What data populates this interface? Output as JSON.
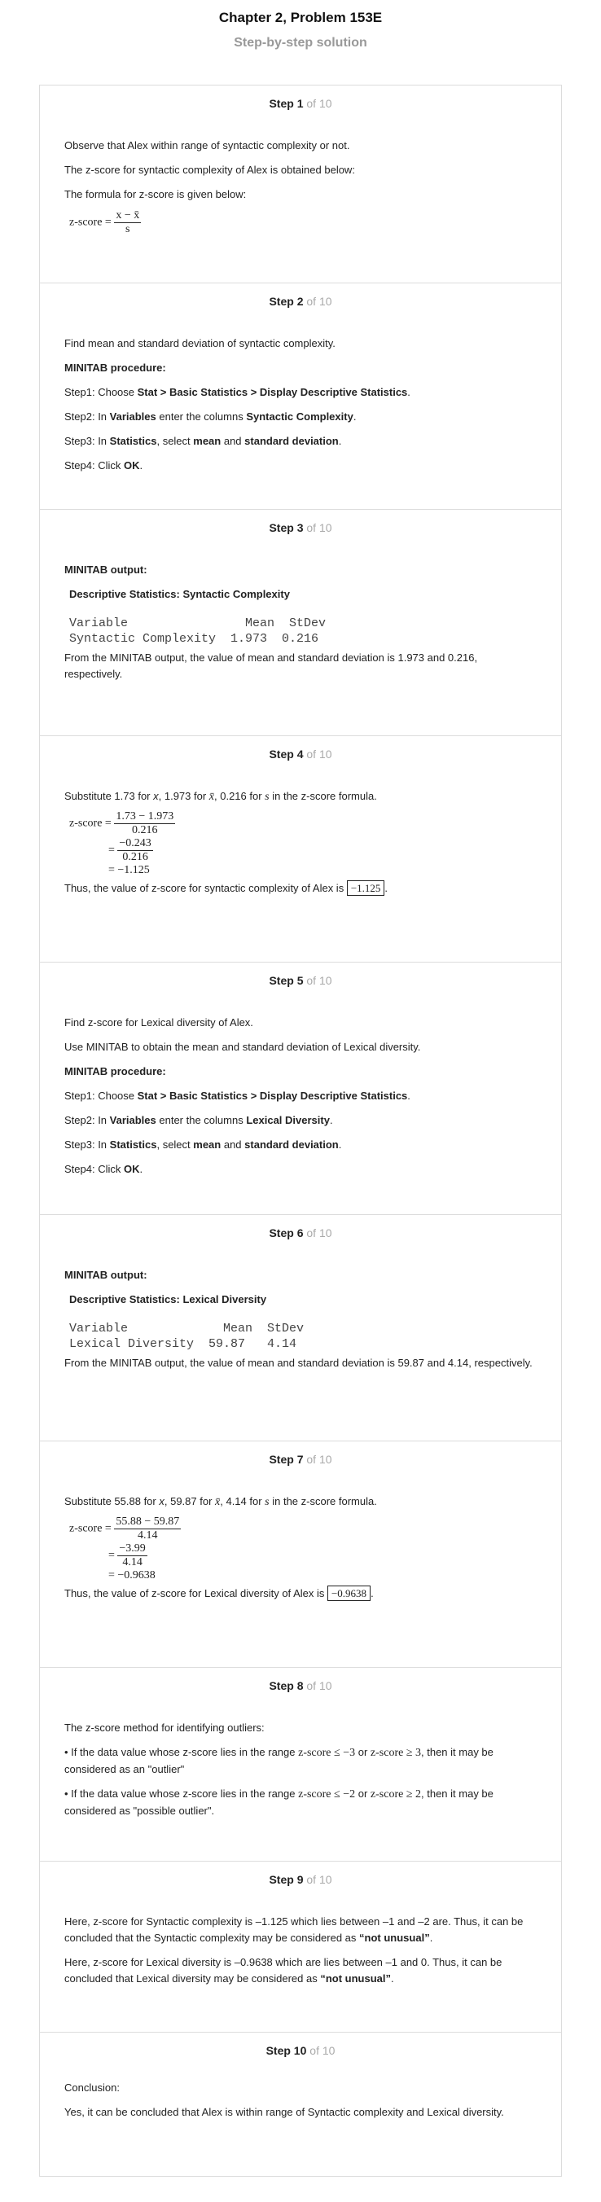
{
  "header": {
    "title": "Chapter 2, Problem 153E",
    "subtitle": "Step-by-step solution"
  },
  "of_label": "of 10",
  "steps": {
    "s1": {
      "label": "Step 1",
      "p1": "Observe that Alex within range of syntactic complexity or not.",
      "p2": "The z-score for syntactic complexity of Alex is obtained below:",
      "p3": "The formula for z-score is given below:",
      "lhs": "z-score =",
      "num": "x − x̄",
      "den": "s"
    },
    "s2": {
      "label": "Step 2",
      "p1": "Find mean and standard deviation of syntactic complexity.",
      "proc": "MINITAB procedure:",
      "step1_pre": "Step1: Choose ",
      "step1_bold": "Stat > Basic Statistics > Display Descriptive Statistics",
      "step1_post": ".",
      "step2_pre": "Step2: In ",
      "step2_bold1": "Variables",
      "step2_mid": " enter the columns ",
      "step2_bold2": "Syntactic Complexity",
      "step2_post": ".",
      "step3_pre": "Step3: In ",
      "step3_bold1": "Statistics",
      "step3_mid1": ", select ",
      "step3_bold2": "mean",
      "step3_mid2": " and ",
      "step3_bold3": "standard deviation",
      "step3_post": ".",
      "step4_pre": "Step4: Click ",
      "step4_bold": "OK",
      "step4_post": "."
    },
    "s3": {
      "label": "Step 3",
      "output": "MINITAB output:",
      "desc": "Descriptive Statistics: Syntactic Complexity",
      "table_header": "Variable                Mean  StDev",
      "table_row": "Syntactic Complexity  1.973  0.216",
      "p1": "From the MINITAB output, the value of mean and standard deviation is 1.973 and 0.216, respectively."
    },
    "s4": {
      "label": "Step 4",
      "p1_a": "Substitute 1.73 for ",
      "p1_x": "x",
      "p1_b": ", 1.973 for ",
      "p1_xbar": "x̄",
      "p1_c": ", 0.216 for ",
      "p1_s": "s",
      "p1_d": " in the z-score formula.",
      "lhs": "z-score =",
      "f1_num": "1.73 − 1.973",
      "f1_den": "0.216",
      "f2_num": "−0.243",
      "f2_den": "0.216",
      "eq3": "= −1.125",
      "concl_pre": "Thus, the value of z-score for syntactic complexity of Alex is ",
      "concl_val": "−1.125",
      "concl_post": "."
    },
    "s5": {
      "label": "Step 5",
      "p1": "Find z-score for Lexical diversity of Alex.",
      "p2": "Use MINITAB to obtain the mean and standard deviation of Lexical diversity.",
      "proc": "MINITAB procedure:",
      "step1_pre": "Step1: Choose ",
      "step1_bold": "Stat > Basic Statistics > Display Descriptive Statistics",
      "step1_post": ".",
      "step2_pre": "Step2: In ",
      "step2_bold1": "Variables",
      "step2_mid": " enter the columns ",
      "step2_bold2": "Lexical Diversity",
      "step2_post": ".",
      "step3_pre": "Step3: In ",
      "step3_bold1": "Statistics",
      "step3_mid1": ", select ",
      "step3_bold2": "mean",
      "step3_mid2": " and ",
      "step3_bold3": "standard deviation",
      "step3_post": ".",
      "step4_pre": "Step4: Click ",
      "step4_bold": "OK",
      "step4_post": "."
    },
    "s6": {
      "label": "Step 6",
      "output": "MINITAB output:",
      "desc": "Descriptive Statistics: Lexical Diversity",
      "table_header": "Variable             Mean  StDev",
      "table_row": "Lexical Diversity  59.87   4.14",
      "p1": "From the MINITAB output, the value of mean and standard deviation is 59.87 and 4.14, respectively."
    },
    "s7": {
      "label": "Step 7",
      "p1_a": "Substitute 55.88 for ",
      "p1_x": "x",
      "p1_b": ", 59.87 for ",
      "p1_xbar": "x̄",
      "p1_c": ", 4.14 for ",
      "p1_s": "s",
      "p1_d": " in the z-score formula.",
      "lhs": "z-score =",
      "f1_num": "55.88 − 59.87",
      "f1_den": "4.14",
      "f2_num": "−3.99",
      "f2_den": "4.14",
      "eq3": "= −0.9638",
      "concl_pre": "Thus, the value of z-score for Lexical diversity of Alex is ",
      "concl_val": "−0.9638",
      "concl_post": "."
    },
    "s8": {
      "label": "Step 8",
      "p1": "The z-score method for identifying outliers:",
      "b1_pre": "• If the data value whose z-score lies in the range ",
      "b1_m1": "z-score ≤ −3",
      "b1_or": " or ",
      "b1_m2": "z-score ≥ 3",
      "b1_post": ", then it may be considered as an \"outlier\"",
      "b2_pre": "• If the data value whose z-score lies in the range ",
      "b2_m1": "z-score ≤ −2",
      "b2_or": " or ",
      "b2_m2": "z-score ≥ 2",
      "b2_post": ", then it may be considered as \"possible outlier\"."
    },
    "s9": {
      "label": "Step 9",
      "p1_pre": "Here, z-score for Syntactic complexity is –1.125 which lies between –1 and –2 are. Thus, it can be concluded that the Syntactic complexity may be considered as ",
      "p1_bold": "“not unusual”",
      "p1_post": ".",
      "p2_pre": "Here, z-score for Lexical diversity is –0.9638 which are lies between –1 and 0. Thus, it can be concluded that Lexical diversity may be considered as ",
      "p2_bold": "“not unusual”",
      "p2_post": "."
    },
    "s10": {
      "label": "Step 10",
      "p1": "Conclusion:",
      "p2": "Yes, it can be concluded that Alex is within range of Syntactic complexity and Lexical diversity."
    }
  }
}
